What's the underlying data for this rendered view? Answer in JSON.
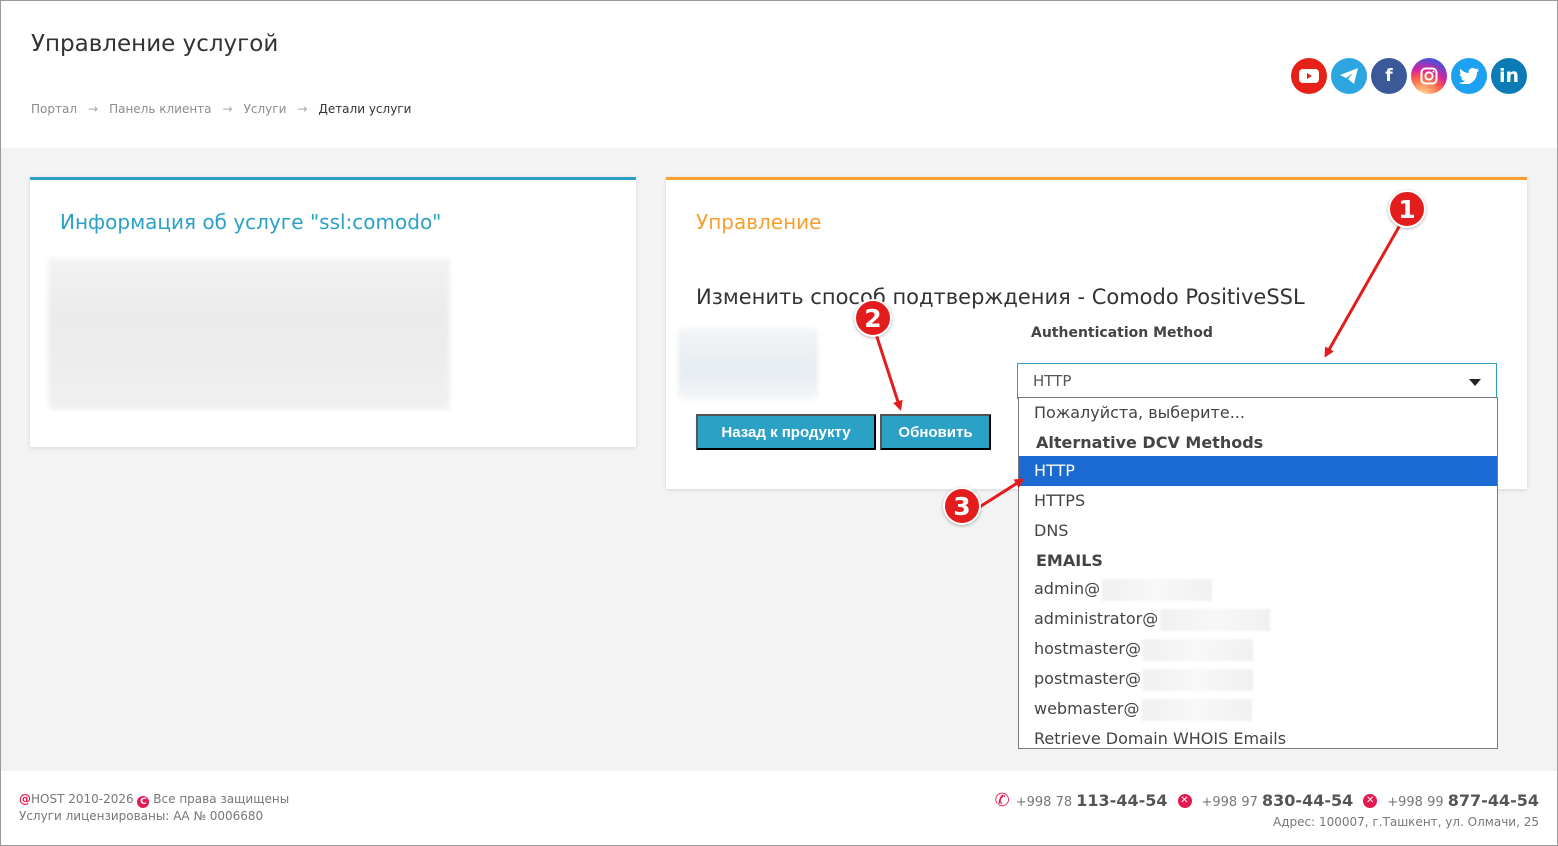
{
  "header": {
    "title": "Управление услугой",
    "breadcrumb": [
      "Портал",
      "Панель клиента",
      "Услуги",
      "Детали услуги"
    ],
    "breadcrumb_separator": "→",
    "social": [
      "youtube-icon",
      "telegram-icon",
      "facebook-icon",
      "instagram-icon",
      "twitter-icon",
      "linkedin-icon"
    ]
  },
  "left_panel": {
    "title": "Информация об услуге \"ssl:comodo\""
  },
  "right_panel": {
    "title": "Управление",
    "change_title": "Изменить способ подтверждения - Comodo PositiveSSL",
    "auth_label": "Authentication Method",
    "select_value": "HTTP",
    "back_button": "Назад к продукту",
    "update_button": "Обновить"
  },
  "dropdown": {
    "placeholder": "Пожалуйста, выберите...",
    "group1": "Alternative DCV Methods",
    "options1": [
      "HTTP",
      "HTTPS",
      "DNS"
    ],
    "selected": "HTTP",
    "group2": "EMAILS",
    "emails": [
      "admin@",
      "administrator@",
      "hostmaster@",
      "postmaster@",
      "webmaster@"
    ],
    "whois": "Retrieve Domain WHOIS Emails"
  },
  "annotations": [
    "1",
    "2",
    "3"
  ],
  "footer": {
    "brand_at": "@",
    "copyright": "HOST 2010-2026",
    "copyright_icon": "C",
    "rights": "Все права защищены",
    "license": "Услуги лицензированы: АА № 0006680",
    "phones": [
      {
        "prefix": "+998 78",
        "number": "113-44-54"
      },
      {
        "prefix": "+998 97",
        "number": "830-44-54"
      },
      {
        "prefix": "+998 99",
        "number": "877-44-54"
      }
    ],
    "address": "Адрес: 100007, г.Ташкент, ул. Олмачи, 25"
  },
  "colors": {
    "accent_blue": "#2ba1c5",
    "accent_orange": "#f5a02e",
    "selected_option": "#1a6ad2",
    "annotation_red": "#e31d1d",
    "brand_pink": "#e5194f"
  }
}
